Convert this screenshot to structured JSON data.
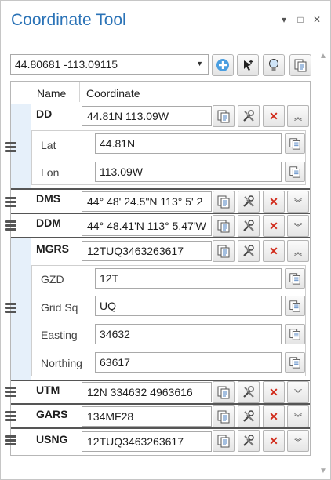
{
  "window": {
    "title": "Coordinate Tool",
    "buttons": [
      "▾",
      "□",
      "✕"
    ]
  },
  "input": {
    "value": "44.80681 -113.09115"
  },
  "toolbar": [
    {
      "name": "add-button",
      "icon": "plus-icon"
    },
    {
      "name": "map-point-button",
      "icon": "map-point-icon"
    },
    {
      "name": "flash-button",
      "icon": "lightbulb-icon"
    },
    {
      "name": "copy-all-button",
      "icon": "copy-icon"
    }
  ],
  "table": {
    "col_name": "Name",
    "col_coord": "Coordinate"
  },
  "rows": {
    "dd": {
      "name": "DD",
      "value": "44.81N 113.09W",
      "expanded": true,
      "sub": [
        {
          "label": "Lat",
          "value": "44.81N"
        },
        {
          "label": "Lon",
          "value": "113.09W"
        }
      ]
    },
    "dms": {
      "name": "DMS",
      "value": "44° 48' 24.5\"N 113° 5' 2",
      "expanded": false
    },
    "ddm": {
      "name": "DDM",
      "value": "44° 48.41'N 113° 5.47'W",
      "expanded": false
    },
    "mgrs": {
      "name": "MGRS",
      "value": "12TUQ3463263617",
      "expanded": true,
      "sub": [
        {
          "label": "GZD",
          "value": "12T"
        },
        {
          "label": "Grid Sq",
          "value": "UQ"
        },
        {
          "label": "Easting",
          "value": "34632"
        },
        {
          "label": "Northing",
          "value": "63617"
        }
      ]
    },
    "utm": {
      "name": "UTM",
      "value": "12N 334632 4963616",
      "expanded": false
    },
    "gars": {
      "name": "GARS",
      "value": "134MF28",
      "expanded": false
    },
    "usng": {
      "name": "USNG",
      "value": "12TUQ3463263617",
      "expanded": false
    }
  },
  "colors": {
    "title": "#2b73b7",
    "delete": "#d12a1a"
  }
}
